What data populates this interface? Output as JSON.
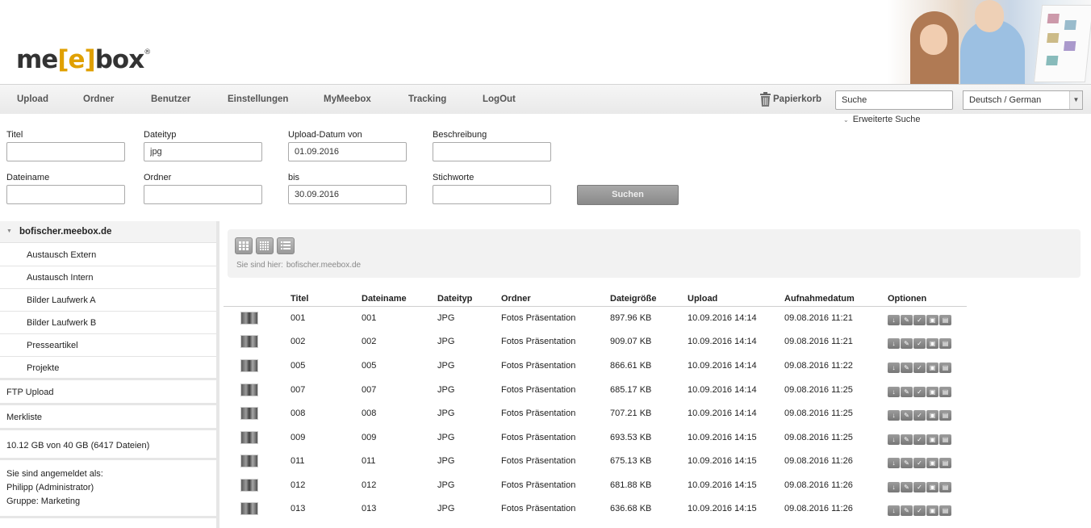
{
  "logo": {
    "text_main": "me",
    "text_bracket": "[e]",
    "text_end": "box",
    "reg": "®"
  },
  "nav": {
    "items": [
      "Upload",
      "Ordner",
      "Benutzer",
      "Einstellungen",
      "MyMeebox",
      "Tracking",
      "LogOut"
    ],
    "trash_label": "Papierkorb",
    "search_value": "Suche",
    "language_value": "Deutsch / German",
    "advanced_search": "Erweiterte Suche"
  },
  "form": {
    "title_label": "Titel",
    "title_value": "",
    "filetype_label": "Dateityp",
    "filetype_value": "jpg",
    "upload_from_label": "Upload-Datum von",
    "upload_from_value": "01.09.2016",
    "description_label": "Beschreibung",
    "description_value": "",
    "filename_label": "Dateiname",
    "filename_value": "",
    "folder_label": "Ordner",
    "folder_value": "",
    "to_label": "bis",
    "to_value": "30.09.2016",
    "keywords_label": "Stichworte",
    "keywords_value": "",
    "search_button": "Suchen"
  },
  "sidebar": {
    "root": "bofischer.meebox.de",
    "folders": [
      "Austausch Extern",
      "Austausch Intern",
      "Bilder Laufwerk A",
      "Bilder Laufwerk B",
      "Presseartikel",
      "Projekte"
    ],
    "ftp": "FTP Upload",
    "watchlist": "Merkliste",
    "storage": "10.12 GB von 40 GB (6417 Dateien)",
    "logged_in_label": "Sie sind angemeldet als:",
    "user": "Philipp (Administrator)",
    "group": "Gruppe: Marketing"
  },
  "breadcrumb": {
    "label": "Sie sind hier:",
    "path": "bofischer.meebox.de"
  },
  "table": {
    "headers": [
      "Titel",
      "Dateiname",
      "Dateityp",
      "Ordner",
      "Dateigröße",
      "Upload",
      "Aufnahmedatum",
      "Optionen"
    ],
    "rows": [
      {
        "title": "001",
        "filename": "001",
        "type": "JPG",
        "folder": "Fotos Präsentation",
        "size": "897.96 KB",
        "upload": "10.09.2016 14:14",
        "taken": "09.08.2016 11:21"
      },
      {
        "title": "002",
        "filename": "002",
        "type": "JPG",
        "folder": "Fotos Präsentation",
        "size": "909.07 KB",
        "upload": "10.09.2016 14:14",
        "taken": "09.08.2016 11:21"
      },
      {
        "title": "005",
        "filename": "005",
        "type": "JPG",
        "folder": "Fotos Präsentation",
        "size": "866.61 KB",
        "upload": "10.09.2016 14:14",
        "taken": "09.08.2016 11:22"
      },
      {
        "title": "007",
        "filename": "007",
        "type": "JPG",
        "folder": "Fotos Präsentation",
        "size": "685.17 KB",
        "upload": "10.09.2016 14:14",
        "taken": "09.08.2016 11:25"
      },
      {
        "title": "008",
        "filename": "008",
        "type": "JPG",
        "folder": "Fotos Präsentation",
        "size": "707.21 KB",
        "upload": "10.09.2016 14:14",
        "taken": "09.08.2016 11:25"
      },
      {
        "title": "009",
        "filename": "009",
        "type": "JPG",
        "folder": "Fotos Präsentation",
        "size": "693.53 KB",
        "upload": "10.09.2016 14:15",
        "taken": "09.08.2016 11:25"
      },
      {
        "title": "011",
        "filename": "011",
        "type": "JPG",
        "folder": "Fotos Präsentation",
        "size": "675.13 KB",
        "upload": "10.09.2016 14:15",
        "taken": "09.08.2016 11:26"
      },
      {
        "title": "012",
        "filename": "012",
        "type": "JPG",
        "folder": "Fotos Präsentation",
        "size": "681.88 KB",
        "upload": "10.09.2016 14:15",
        "taken": "09.08.2016 11:26"
      },
      {
        "title": "013",
        "filename": "013",
        "type": "JPG",
        "folder": "Fotos Präsentation",
        "size": "636.68 KB",
        "upload": "10.09.2016 14:15",
        "taken": "09.08.2016 11:26"
      }
    ],
    "option_icons": [
      "download-icon",
      "edit-icon",
      "check-icon",
      "lock-icon",
      "trash-icon"
    ]
  }
}
